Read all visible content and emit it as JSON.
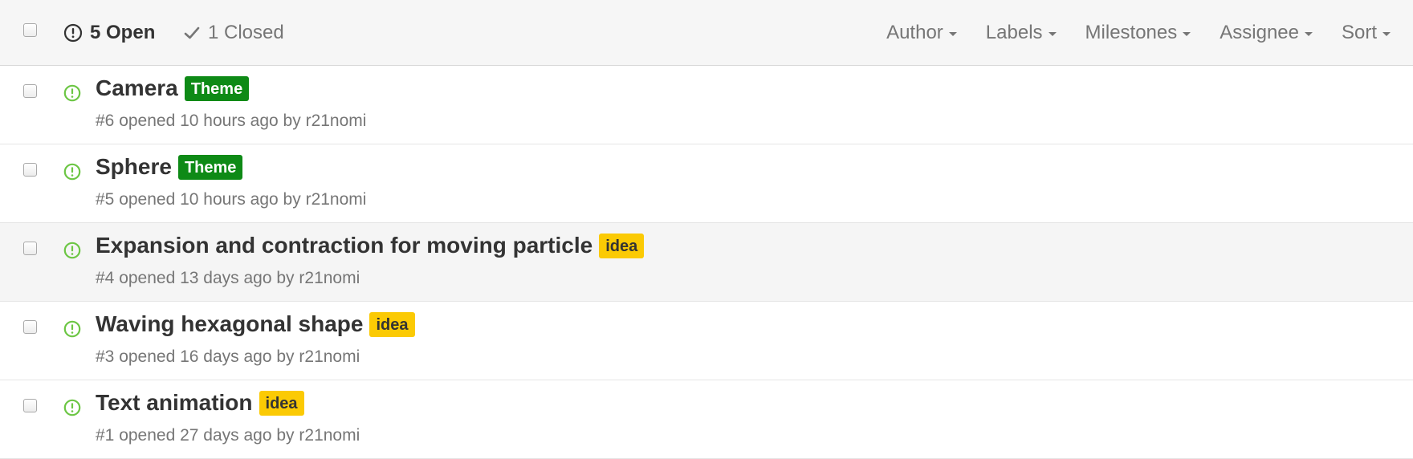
{
  "header": {
    "open_count_label": "5 Open",
    "closed_count_label": "1 Closed",
    "filters": [
      {
        "label": "Author"
      },
      {
        "label": "Labels"
      },
      {
        "label": "Milestones"
      },
      {
        "label": "Assignee"
      },
      {
        "label": "Sort"
      }
    ]
  },
  "colors": {
    "open_icon": "#6cc644",
    "label_theme_bg": "#0e8a16",
    "label_theme_fg": "#ffffff",
    "label_idea_bg": "#fbca04",
    "label_idea_fg": "#333333"
  },
  "issues": [
    {
      "title": "Camera",
      "label": {
        "text": "Theme",
        "bg": "#0e8a16",
        "fg": "#ffffff"
      },
      "number": "#6",
      "opened": "opened 10 hours ago by",
      "author": "r21nomi",
      "icon": "issue-opened-icon",
      "highlighted": false
    },
    {
      "title": "Sphere",
      "label": {
        "text": "Theme",
        "bg": "#0e8a16",
        "fg": "#ffffff"
      },
      "number": "#5",
      "opened": "opened 10 hours ago by",
      "author": "r21nomi",
      "icon": "issue-opened-icon",
      "highlighted": false
    },
    {
      "title": "Expansion and contraction for moving particle",
      "label": {
        "text": "idea",
        "bg": "#fbca04",
        "fg": "#333333"
      },
      "number": "#4",
      "opened": "opened 13 days ago by",
      "author": "r21nomi",
      "icon": "issue-opened-icon",
      "highlighted": true
    },
    {
      "title": "Waving hexagonal shape",
      "label": {
        "text": "idea",
        "bg": "#fbca04",
        "fg": "#333333"
      },
      "number": "#3",
      "opened": "opened 16 days ago by",
      "author": "r21nomi",
      "icon": "issue-opened-icon",
      "highlighted": false
    },
    {
      "title": "Text animation",
      "label": {
        "text": "idea",
        "bg": "#fbca04",
        "fg": "#333333"
      },
      "number": "#1",
      "opened": "opened 27 days ago by",
      "author": "r21nomi",
      "icon": "issue-opened-icon",
      "highlighted": false
    }
  ]
}
